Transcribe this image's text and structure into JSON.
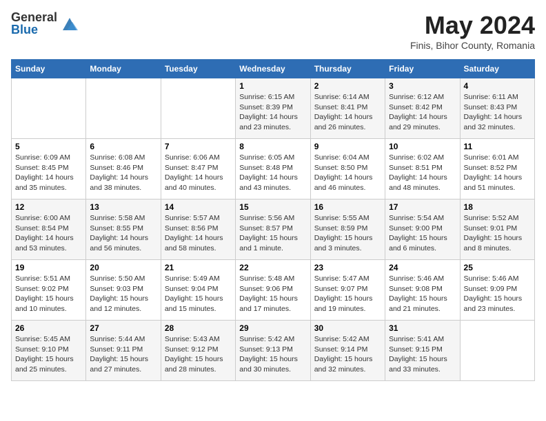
{
  "header": {
    "logo_general": "General",
    "logo_blue": "Blue",
    "title": "May 2024",
    "location": "Finis, Bihor County, Romania"
  },
  "columns": [
    "Sunday",
    "Monday",
    "Tuesday",
    "Wednesday",
    "Thursday",
    "Friday",
    "Saturday"
  ],
  "weeks": [
    [
      {
        "day": "",
        "info": ""
      },
      {
        "day": "",
        "info": ""
      },
      {
        "day": "",
        "info": ""
      },
      {
        "day": "1",
        "info": "Sunrise: 6:15 AM\nSunset: 8:39 PM\nDaylight: 14 hours\nand 23 minutes."
      },
      {
        "day": "2",
        "info": "Sunrise: 6:14 AM\nSunset: 8:41 PM\nDaylight: 14 hours\nand 26 minutes."
      },
      {
        "day": "3",
        "info": "Sunrise: 6:12 AM\nSunset: 8:42 PM\nDaylight: 14 hours\nand 29 minutes."
      },
      {
        "day": "4",
        "info": "Sunrise: 6:11 AM\nSunset: 8:43 PM\nDaylight: 14 hours\nand 32 minutes."
      }
    ],
    [
      {
        "day": "5",
        "info": "Sunrise: 6:09 AM\nSunset: 8:45 PM\nDaylight: 14 hours\nand 35 minutes."
      },
      {
        "day": "6",
        "info": "Sunrise: 6:08 AM\nSunset: 8:46 PM\nDaylight: 14 hours\nand 38 minutes."
      },
      {
        "day": "7",
        "info": "Sunrise: 6:06 AM\nSunset: 8:47 PM\nDaylight: 14 hours\nand 40 minutes."
      },
      {
        "day": "8",
        "info": "Sunrise: 6:05 AM\nSunset: 8:48 PM\nDaylight: 14 hours\nand 43 minutes."
      },
      {
        "day": "9",
        "info": "Sunrise: 6:04 AM\nSunset: 8:50 PM\nDaylight: 14 hours\nand 46 minutes."
      },
      {
        "day": "10",
        "info": "Sunrise: 6:02 AM\nSunset: 8:51 PM\nDaylight: 14 hours\nand 48 minutes."
      },
      {
        "day": "11",
        "info": "Sunrise: 6:01 AM\nSunset: 8:52 PM\nDaylight: 14 hours\nand 51 minutes."
      }
    ],
    [
      {
        "day": "12",
        "info": "Sunrise: 6:00 AM\nSunset: 8:54 PM\nDaylight: 14 hours\nand 53 minutes."
      },
      {
        "day": "13",
        "info": "Sunrise: 5:58 AM\nSunset: 8:55 PM\nDaylight: 14 hours\nand 56 minutes."
      },
      {
        "day": "14",
        "info": "Sunrise: 5:57 AM\nSunset: 8:56 PM\nDaylight: 14 hours\nand 58 minutes."
      },
      {
        "day": "15",
        "info": "Sunrise: 5:56 AM\nSunset: 8:57 PM\nDaylight: 15 hours\nand 1 minute."
      },
      {
        "day": "16",
        "info": "Sunrise: 5:55 AM\nSunset: 8:59 PM\nDaylight: 15 hours\nand 3 minutes."
      },
      {
        "day": "17",
        "info": "Sunrise: 5:54 AM\nSunset: 9:00 PM\nDaylight: 15 hours\nand 6 minutes."
      },
      {
        "day": "18",
        "info": "Sunrise: 5:52 AM\nSunset: 9:01 PM\nDaylight: 15 hours\nand 8 minutes."
      }
    ],
    [
      {
        "day": "19",
        "info": "Sunrise: 5:51 AM\nSunset: 9:02 PM\nDaylight: 15 hours\nand 10 minutes."
      },
      {
        "day": "20",
        "info": "Sunrise: 5:50 AM\nSunset: 9:03 PM\nDaylight: 15 hours\nand 12 minutes."
      },
      {
        "day": "21",
        "info": "Sunrise: 5:49 AM\nSunset: 9:04 PM\nDaylight: 15 hours\nand 15 minutes."
      },
      {
        "day": "22",
        "info": "Sunrise: 5:48 AM\nSunset: 9:06 PM\nDaylight: 15 hours\nand 17 minutes."
      },
      {
        "day": "23",
        "info": "Sunrise: 5:47 AM\nSunset: 9:07 PM\nDaylight: 15 hours\nand 19 minutes."
      },
      {
        "day": "24",
        "info": "Sunrise: 5:46 AM\nSunset: 9:08 PM\nDaylight: 15 hours\nand 21 minutes."
      },
      {
        "day": "25",
        "info": "Sunrise: 5:46 AM\nSunset: 9:09 PM\nDaylight: 15 hours\nand 23 minutes."
      }
    ],
    [
      {
        "day": "26",
        "info": "Sunrise: 5:45 AM\nSunset: 9:10 PM\nDaylight: 15 hours\nand 25 minutes."
      },
      {
        "day": "27",
        "info": "Sunrise: 5:44 AM\nSunset: 9:11 PM\nDaylight: 15 hours\nand 27 minutes."
      },
      {
        "day": "28",
        "info": "Sunrise: 5:43 AM\nSunset: 9:12 PM\nDaylight: 15 hours\nand 28 minutes."
      },
      {
        "day": "29",
        "info": "Sunrise: 5:42 AM\nSunset: 9:13 PM\nDaylight: 15 hours\nand 30 minutes."
      },
      {
        "day": "30",
        "info": "Sunrise: 5:42 AM\nSunset: 9:14 PM\nDaylight: 15 hours\nand 32 minutes."
      },
      {
        "day": "31",
        "info": "Sunrise: 5:41 AM\nSunset: 9:15 PM\nDaylight: 15 hours\nand 33 minutes."
      },
      {
        "day": "",
        "info": ""
      }
    ]
  ]
}
